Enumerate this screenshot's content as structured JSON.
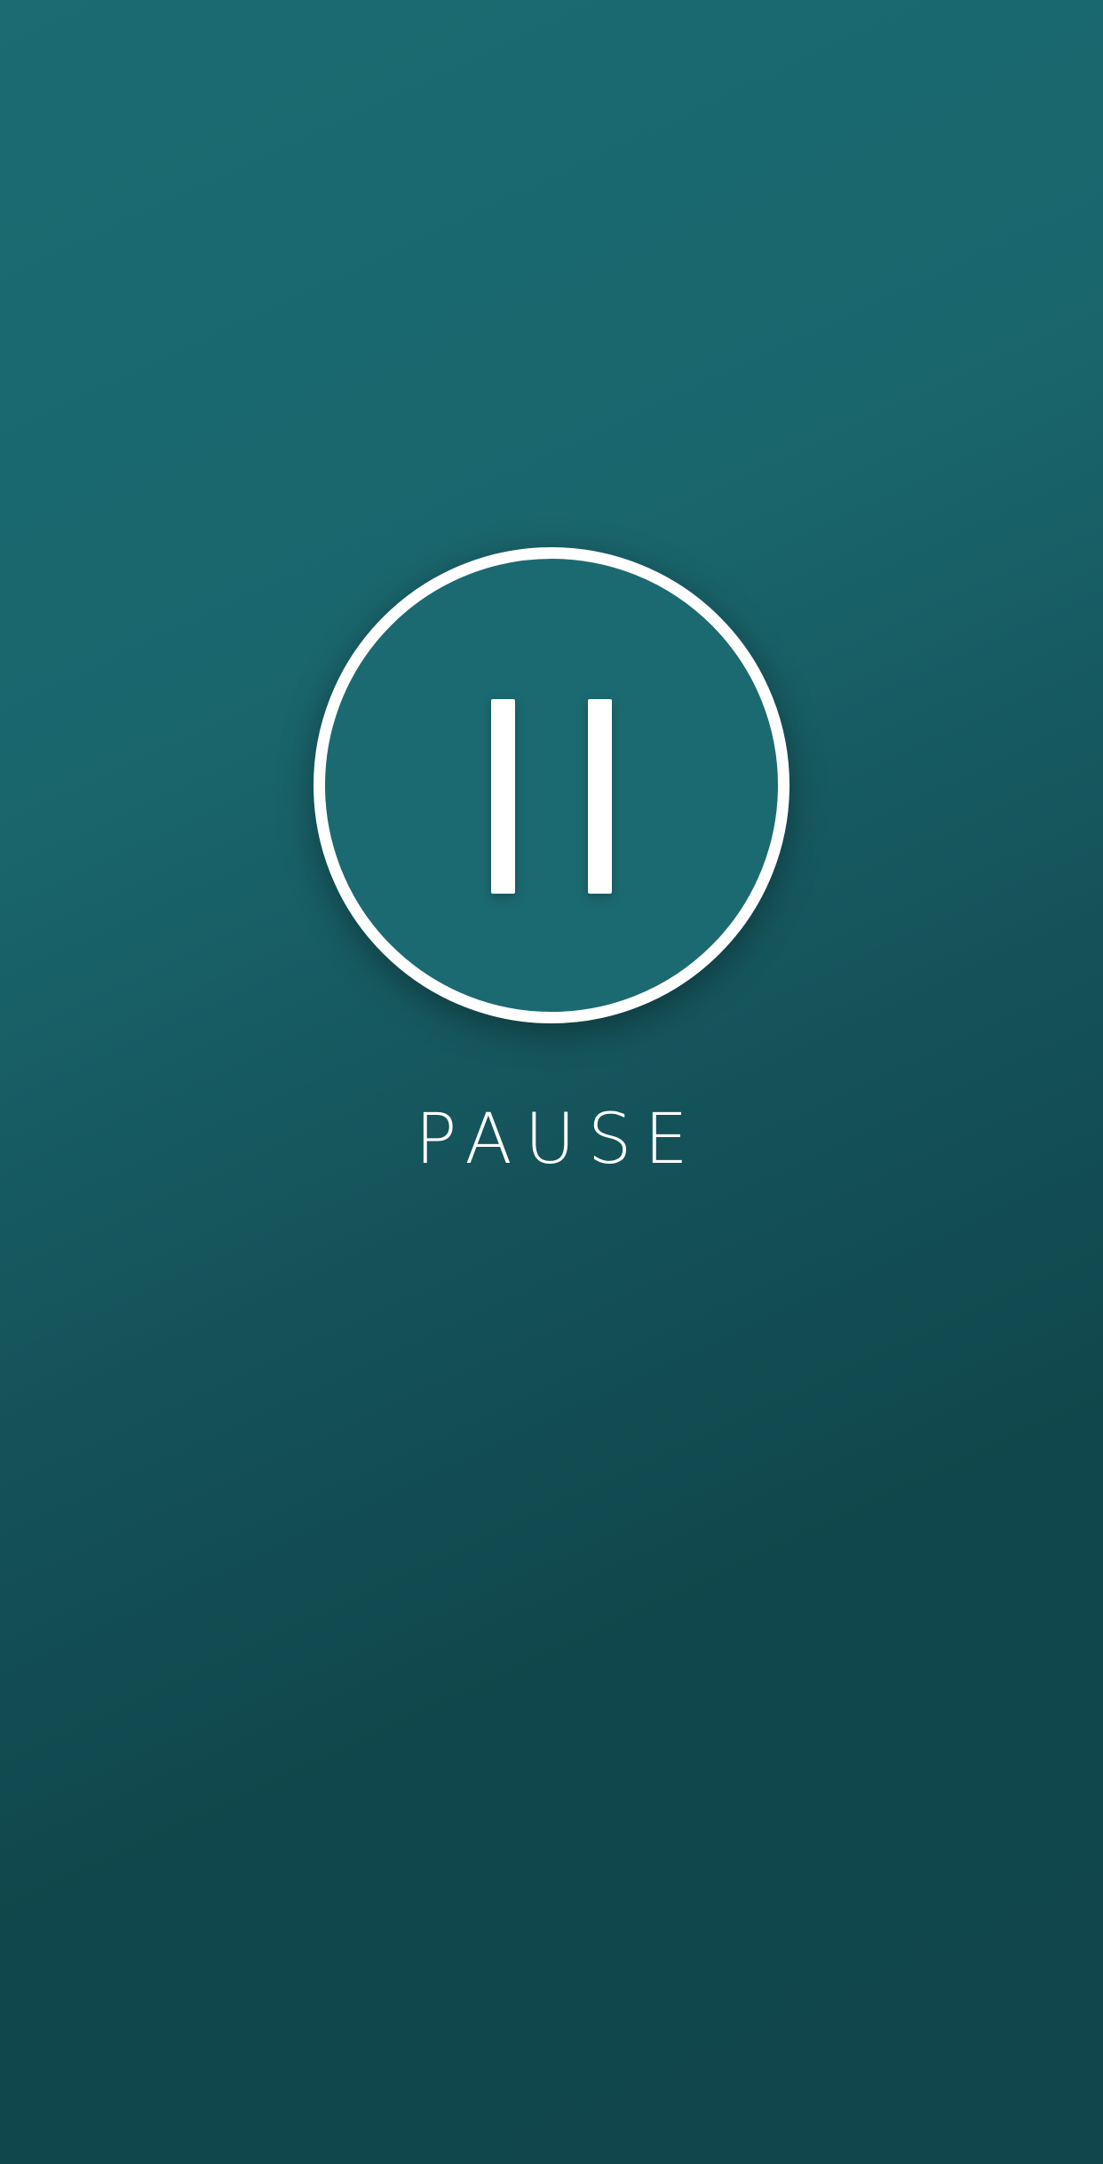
{
  "screen": {
    "background_colors": [
      "#1b6b72",
      "#10474c"
    ]
  },
  "pause_button": {
    "icon": "pause-icon",
    "ring_color": "#ffffff",
    "fill_color": "#1c6a71"
  },
  "status": {
    "label": "PAUSE"
  }
}
